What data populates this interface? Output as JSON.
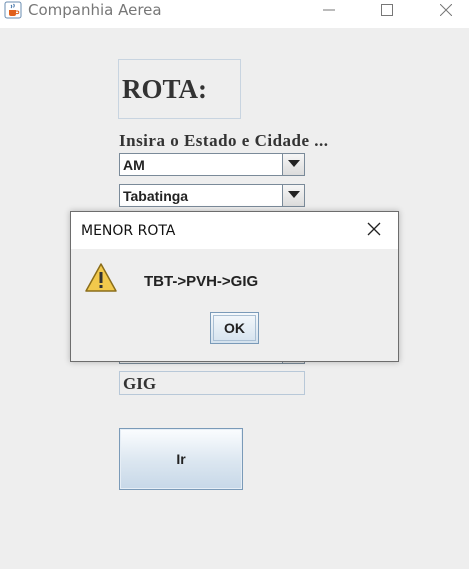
{
  "window": {
    "title": "Companhia Aerea",
    "icon": "java-cup-icon",
    "controls": [
      "minimize-icon",
      "maximize-icon",
      "close-icon"
    ]
  },
  "form": {
    "heading": "ROTA:",
    "instruction": "Insira o Estado e Cidade ...",
    "state_select": {
      "value": "AM"
    },
    "city_select": {
      "value": "Tabatinga"
    },
    "destination_value": "GIG",
    "go_button_label": "Ir"
  },
  "dialog": {
    "title": "MENOR ROTA",
    "icon": "warning-icon",
    "message": "TBT->PVH->GIG",
    "ok_label": "OK"
  }
}
